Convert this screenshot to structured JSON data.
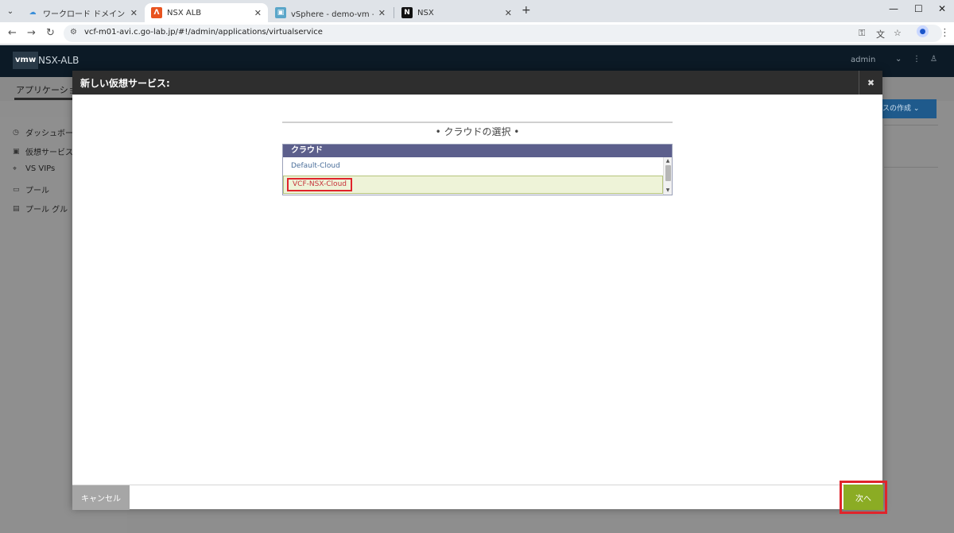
{
  "browser": {
    "tabs": [
      {
        "title": "ワークロード ドメイン - サマリ",
        "icon": "cloud-icon",
        "active": false
      },
      {
        "title": "NSX ALB",
        "icon": "nsx-alb-icon",
        "active": true
      },
      {
        "title": "vSphere - demo-vm - 仮想マシン",
        "icon": "vsphere-icon",
        "active": false
      },
      {
        "title": "NSX",
        "icon": "nsx-icon",
        "active": false
      }
    ],
    "url": "vcf-m01-avi.c.go-lab.jp/#!/admin/applications/virtualservice"
  },
  "app": {
    "logo": "vmw",
    "title": "NSX-ALB",
    "user": "admin",
    "tab_label": "アプリケーショ",
    "create_button": "スの作成",
    "sidebar": [
      {
        "label": "ダッシュボー",
        "icon": "dashboard-icon"
      },
      {
        "label": "仮想サービス",
        "icon": "virtual-service-icon"
      },
      {
        "label": "VS VIPs",
        "icon": "location-pin-icon"
      },
      {
        "label": "プール",
        "icon": "pool-icon"
      },
      {
        "label": "プール グル",
        "icon": "pool-group-icon"
      }
    ]
  },
  "modal": {
    "title": "新しい仮想サービス:",
    "section_heading": "• クラウドの選択 •",
    "list_header": "クラウド",
    "clouds": [
      {
        "label": "Default-Cloud",
        "selected": false
      },
      {
        "label": "VCF-NSX-Cloud",
        "selected": true
      }
    ],
    "cancel_label": "キャンセル",
    "next_label": "次へ"
  },
  "colors": {
    "highlight": "#e0242b",
    "next_button": "#8bac24",
    "list_header": "#5c5f8c",
    "selected_row": "#eef3d8"
  }
}
